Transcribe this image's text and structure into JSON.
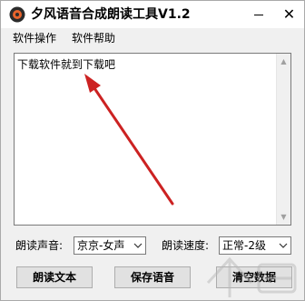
{
  "window": {
    "title": "夕风语音合成朗读工具V1.2",
    "close_glyph": "✕"
  },
  "menu": {
    "items": [
      "软件操作",
      "软件帮助"
    ]
  },
  "editor": {
    "text": "下载软件就到下载吧"
  },
  "settings": {
    "voice_label": "朗读声音:",
    "voice_value": "京京-女声",
    "speed_label": "朗读速度:",
    "speed_value": "正常-2级"
  },
  "buttons": {
    "read": "朗读文本",
    "save": "保存语音",
    "clear": "清空数据"
  },
  "icons": {
    "app": "speaker-app-icon",
    "minimize": "minimize-icon",
    "close": "close-icon",
    "dropdown": "chevron-down-icon",
    "scroll_up": "scroll-up-arrow-icon",
    "scroll_down": "scroll-down-arrow-icon"
  },
  "colors": {
    "annotation_arrow": "#cc2222",
    "app_icon": "#2b2b2b",
    "app_icon_accent": "#e8642c"
  }
}
